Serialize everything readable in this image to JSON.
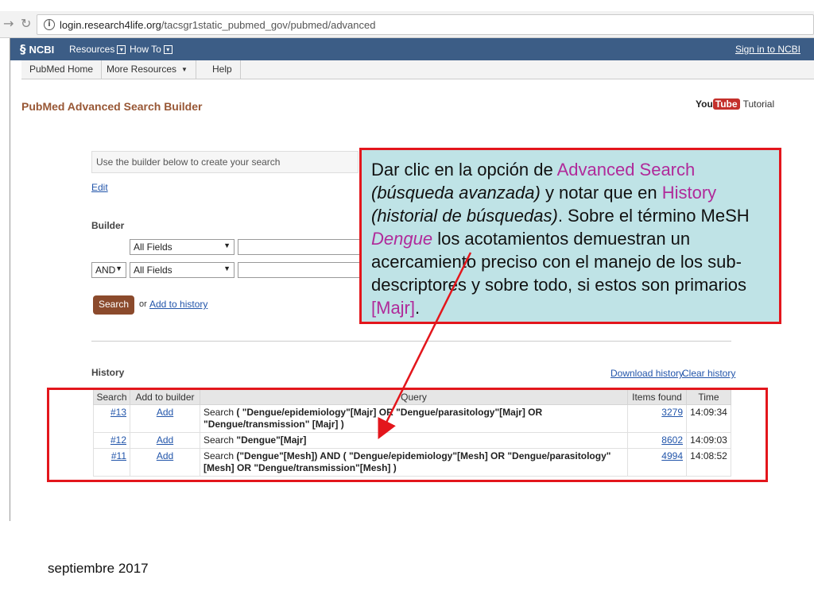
{
  "browser": {
    "back_icon": "back-arrow-icon",
    "reload_icon": "reload-icon",
    "info_icon": "i",
    "url_host": "login.research4life.org",
    "url_path": "/tacsgr1static_pubmed_gov/pubmed/advanced"
  },
  "ncbi_bar": {
    "logo": "NCBI",
    "logo_glyph": "§",
    "resources": "Resources",
    "how_to": "How To",
    "signin": "Sign in to NCBI",
    "background": "#3c5d86"
  },
  "subnav": {
    "items": [
      "PubMed Home",
      "More Resources",
      "Help"
    ]
  },
  "page": {
    "title": "PubMed Advanced Search Builder",
    "youtube_you": "You",
    "youtube_tube": "Tube",
    "tutorial": "Tutorial",
    "builder_placeholder": "Use the builder below to create your search",
    "edit": "Edit",
    "builder_label": "Builder",
    "field1": "All Fields",
    "bool_op": "AND",
    "field2": "All Fields",
    "search_btn": "Search",
    "or_text": "or",
    "add_to_history": "Add to history",
    "history_label": "History",
    "download_history": "Download history",
    "clear_history": "Clear history"
  },
  "history_table": {
    "headers": [
      "Search",
      "Add to builder",
      "Query",
      "Items found",
      "Time"
    ],
    "rows": [
      {
        "num": "#13",
        "add": "Add",
        "prefix": "Search",
        "query": "( \"Dengue/epidemiology\"[Majr] OR \"Dengue/parasitology\"[Majr] OR \"Dengue/transmission\" [Majr] )",
        "items": "3279",
        "time": "14:09:34"
      },
      {
        "num": "#12",
        "add": "Add",
        "prefix": "Search",
        "query": "\"Dengue\"[Majr]",
        "items": "8602",
        "time": "14:09:03"
      },
      {
        "num": "#11",
        "add": "Add",
        "prefix": "Search",
        "query": "(\"Dengue\"[Mesh]) AND ( \"Dengue/epidemiology\"[Mesh] OR \"Dengue/parasitology\"[Mesh] OR \"Dengue/transmission\"[Mesh] )",
        "items": "4994",
        "time": "14:08:52"
      }
    ]
  },
  "callout": {
    "p1": "Dar clic en la opción de ",
    "advanced": "Advanced Search",
    "p2": "(búsqueda avanzada)",
    "p3": " y notar que en ",
    "history": "History",
    "p4": "(historial de búsquedas)",
    "p5": ".  Sobre el término MeSH ",
    "dengue": "Dengue",
    "p6": " los acotamientos demuestran un acercamiento preciso con el manejo de los sub-descriptores y sobre todo, si estos son primarios ",
    "majr": "[Majr]",
    "p7": ".",
    "highlight_color": "#b02a9a",
    "border_color": "#e3161c",
    "background": "#bfe3e6"
  },
  "footer": {
    "date": "septiembre 2017"
  }
}
